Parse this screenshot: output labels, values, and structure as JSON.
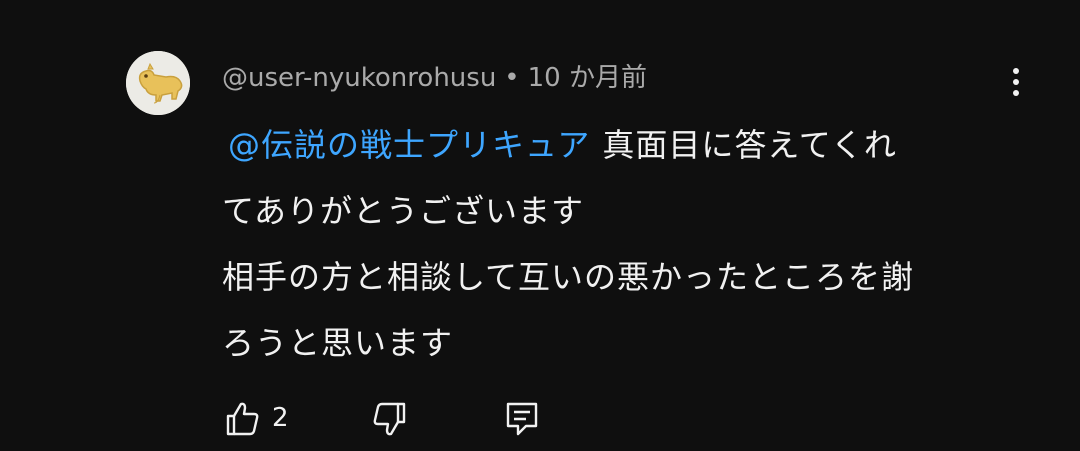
{
  "comment": {
    "author": "@user-nyukonrohusu",
    "separator": "•",
    "timestamp": "10 か月前",
    "mention": "@伝説の戦士プリキュア",
    "lines": [
      "真面目に答えてくれ",
      "てありがとうございます",
      "相手の方と相談して互いの悪かったところを謝",
      "ろうと思います"
    ],
    "like_count": "2"
  },
  "icons": {
    "avatar": "dinosaur-avatar",
    "menu": "more-vert-icon",
    "like": "thumbs-up-icon",
    "dislike": "thumbs-down-icon",
    "reply": "reply-comment-icon"
  },
  "colors": {
    "background": "#0f0f0f",
    "text": "#f1f1f1",
    "meta": "#aaaaaa",
    "mention": "#3ea6ff"
  }
}
